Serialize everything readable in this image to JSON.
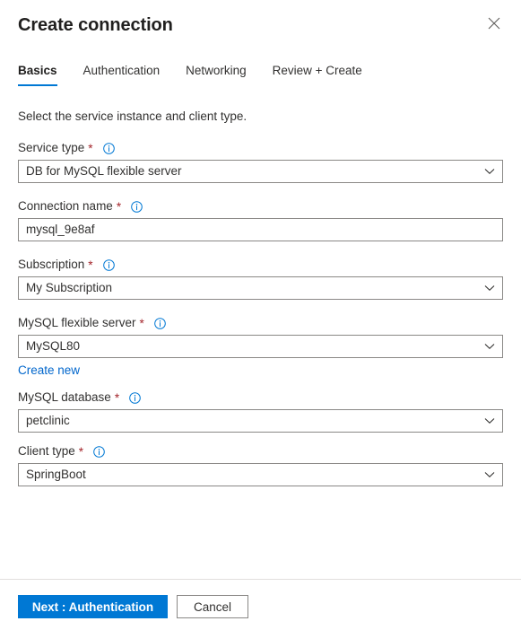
{
  "header": {
    "title": "Create connection",
    "close_icon": "close-icon"
  },
  "tabs": [
    {
      "label": "Basics",
      "active": true
    },
    {
      "label": "Authentication",
      "active": false
    },
    {
      "label": "Networking",
      "active": false
    },
    {
      "label": "Review + Create",
      "active": false
    }
  ],
  "main": {
    "intro": "Select the service instance and client type.",
    "fields": [
      {
        "label": "Service type",
        "required": "*",
        "info_icon": "info-icon",
        "type": "dropdown",
        "value": "DB for MySQL flexible server"
      },
      {
        "label": "Connection name",
        "required": "*",
        "info_icon": "info-icon",
        "type": "text",
        "value": "mysql_9e8af",
        "placeholder": ""
      },
      {
        "label": "Subscription",
        "required": "*",
        "info_icon": "info-icon",
        "type": "dropdown",
        "value": "My Subscription"
      },
      {
        "label": "MySQL flexible server",
        "required": "*",
        "info_icon": "info-icon",
        "type": "dropdown",
        "value": "MySQL80",
        "link": "Create new"
      },
      {
        "label": "MySQL database",
        "required": "*",
        "info_icon": "info-icon",
        "type": "dropdown",
        "value": "petclinic"
      },
      {
        "label": "Client type",
        "required": "*",
        "info_icon": "info-icon",
        "type": "dropdown",
        "value": "SpringBoot"
      }
    ]
  },
  "footer": {
    "next_label": "Next : Authentication",
    "cancel_label": "Cancel"
  },
  "colors": {
    "accent": "#0078d4",
    "link": "#0066cc",
    "required": "#a4262c",
    "border": "#8a8886",
    "divider": "#e1dfdd",
    "text": "#323130"
  }
}
